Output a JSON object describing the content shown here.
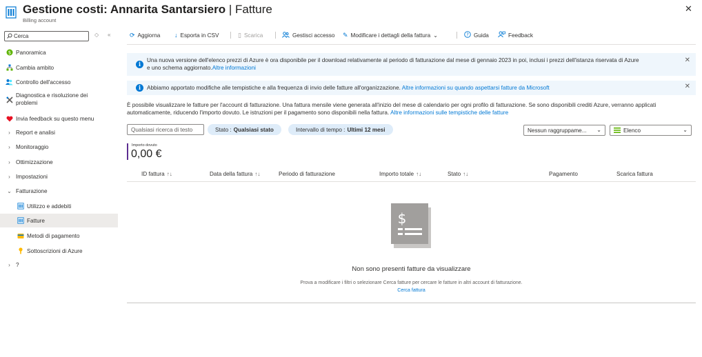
{
  "header": {
    "title_main": "Gestione costi: Annarita Santarsiero",
    "title_sep": " | ",
    "title_page": "Fatture",
    "more": "···",
    "subtitle": "Billing account",
    "close": "✕"
  },
  "sidebar": {
    "search_placeholder": "Cerca",
    "items": [
      {
        "label": "Panoramica",
        "icon": "overview-icon"
      },
      {
        "label": "Cambia ambito",
        "icon": "scope-icon"
      },
      {
        "label": "Controllo dell'accesso",
        "icon": "access-control-icon"
      },
      {
        "label": "Diagnostica e risoluzione dei problemi",
        "icon": "diagnose-icon"
      },
      {
        "label": "Invia feedback su questo menu",
        "icon": "heart-icon"
      },
      {
        "label": "Report e analisi",
        "icon": "chevron-right-icon"
      },
      {
        "label": "Monitoraggio",
        "icon": "chevron-right-icon"
      },
      {
        "label": "Ottimizzazione",
        "icon": "chevron-right-icon"
      },
      {
        "label": "Impostazioni",
        "icon": "chevron-right-icon"
      },
      {
        "label": "Fatturazione",
        "icon": "chevron-down-icon"
      },
      {
        "label": "Utilizzo e addebiti",
        "icon": "usage-icon"
      },
      {
        "label": "Fatture",
        "icon": "invoices-icon"
      },
      {
        "label": "Metodi di pagamento",
        "icon": "payment-icon"
      },
      {
        "label": "Sottoscrizioni di Azure",
        "icon": "key-icon"
      },
      {
        "label": "?",
        "icon": "chevron-right-icon"
      }
    ]
  },
  "toolbar": {
    "refresh": "Aggiorna",
    "export": "Esporta in CSV",
    "download": "Scarica",
    "manage_access": "Gestisci accesso",
    "edit_details": "Modificare i dettagli della fattura",
    "help": "Guida",
    "feedback": "Feedback"
  },
  "banners": [
    {
      "text": "Una nuova versione dell'elenco prezzi di Azure è ora disponibile per il download relativamente al periodo di fatturazione dal mese di gennaio 2023 in poi, inclusi i prezzi dell'istanza riservata di Azure e uno schema aggiornato.",
      "link": "Altre informazioni"
    },
    {
      "text": "Abbiamo apportato modifiche alle tempistiche e alla frequenza di invio delle fatture all'organizzazione.",
      "link": "Altre informazioni su quando aspettarsi fatture da Microsoft"
    }
  ],
  "description": {
    "text": "È possibile visualizzare le fatture per l'account di fatturazione. Una fattura mensile viene generata all'inizio del mese di calendario per ogni profilo di fatturazione. Se sono disponibili crediti Azure, verranno applicati automaticamente, riducendo l'importo dovuto. Le istruzioni per il pagamento sono disponibili nella fattura.",
    "link": "Altre informazioni sulle tempistiche delle fatture"
  },
  "filters": {
    "search_placeholder": "Qualsiasi ricerca di testo",
    "status_label": "Stato :",
    "status_value": "Qualsiasi stato",
    "range_label": "Intervallo di tempo :",
    "range_value": "Ultimi 12 mesi",
    "grouping": "Nessun raggruppame...",
    "view": "Elenco"
  },
  "amount": {
    "label": "Importo dovuto",
    "value": "0,00 €"
  },
  "table": {
    "columns": [
      "ID fattura",
      "Data della fattura",
      "Periodo di fatturazione",
      "Importo totale",
      "Stato",
      "Pagamento",
      "Scarica fattura"
    ]
  },
  "empty": {
    "title": "Non sono presenti fatture da visualizzare",
    "description": "Prova a modificare i filtri o selezionare Cerca fatture per cercare le fatture in altri account di fatturazione.",
    "link": "Cerca fattura"
  },
  "colors": {
    "accent": "#0078d4",
    "banner_bg": "#eff6fc",
    "pill_bg": "#deecf9",
    "selected_nav": "#edebe9"
  }
}
